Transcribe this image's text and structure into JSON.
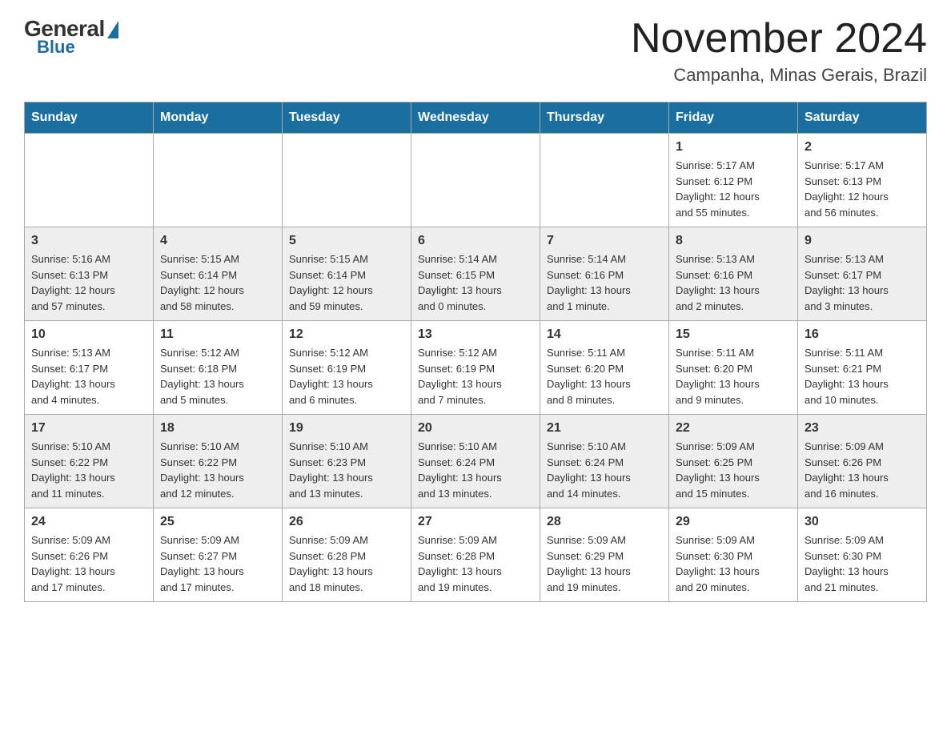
{
  "header": {
    "logo": {
      "general_text": "General",
      "blue_text": "Blue"
    },
    "title": "November 2024",
    "location": "Campanha, Minas Gerais, Brazil"
  },
  "calendar": {
    "days_of_week": [
      "Sunday",
      "Monday",
      "Tuesday",
      "Wednesday",
      "Thursday",
      "Friday",
      "Saturday"
    ],
    "weeks": [
      [
        {
          "day": "",
          "info": ""
        },
        {
          "day": "",
          "info": ""
        },
        {
          "day": "",
          "info": ""
        },
        {
          "day": "",
          "info": ""
        },
        {
          "day": "",
          "info": ""
        },
        {
          "day": "1",
          "info": "Sunrise: 5:17 AM\nSunset: 6:12 PM\nDaylight: 12 hours\nand 55 minutes."
        },
        {
          "day": "2",
          "info": "Sunrise: 5:17 AM\nSunset: 6:13 PM\nDaylight: 12 hours\nand 56 minutes."
        }
      ],
      [
        {
          "day": "3",
          "info": "Sunrise: 5:16 AM\nSunset: 6:13 PM\nDaylight: 12 hours\nand 57 minutes."
        },
        {
          "day": "4",
          "info": "Sunrise: 5:15 AM\nSunset: 6:14 PM\nDaylight: 12 hours\nand 58 minutes."
        },
        {
          "day": "5",
          "info": "Sunrise: 5:15 AM\nSunset: 6:14 PM\nDaylight: 12 hours\nand 59 minutes."
        },
        {
          "day": "6",
          "info": "Sunrise: 5:14 AM\nSunset: 6:15 PM\nDaylight: 13 hours\nand 0 minutes."
        },
        {
          "day": "7",
          "info": "Sunrise: 5:14 AM\nSunset: 6:16 PM\nDaylight: 13 hours\nand 1 minute."
        },
        {
          "day": "8",
          "info": "Sunrise: 5:13 AM\nSunset: 6:16 PM\nDaylight: 13 hours\nand 2 minutes."
        },
        {
          "day": "9",
          "info": "Sunrise: 5:13 AM\nSunset: 6:17 PM\nDaylight: 13 hours\nand 3 minutes."
        }
      ],
      [
        {
          "day": "10",
          "info": "Sunrise: 5:13 AM\nSunset: 6:17 PM\nDaylight: 13 hours\nand 4 minutes."
        },
        {
          "day": "11",
          "info": "Sunrise: 5:12 AM\nSunset: 6:18 PM\nDaylight: 13 hours\nand 5 minutes."
        },
        {
          "day": "12",
          "info": "Sunrise: 5:12 AM\nSunset: 6:19 PM\nDaylight: 13 hours\nand 6 minutes."
        },
        {
          "day": "13",
          "info": "Sunrise: 5:12 AM\nSunset: 6:19 PM\nDaylight: 13 hours\nand 7 minutes."
        },
        {
          "day": "14",
          "info": "Sunrise: 5:11 AM\nSunset: 6:20 PM\nDaylight: 13 hours\nand 8 minutes."
        },
        {
          "day": "15",
          "info": "Sunrise: 5:11 AM\nSunset: 6:20 PM\nDaylight: 13 hours\nand 9 minutes."
        },
        {
          "day": "16",
          "info": "Sunrise: 5:11 AM\nSunset: 6:21 PM\nDaylight: 13 hours\nand 10 minutes."
        }
      ],
      [
        {
          "day": "17",
          "info": "Sunrise: 5:10 AM\nSunset: 6:22 PM\nDaylight: 13 hours\nand 11 minutes."
        },
        {
          "day": "18",
          "info": "Sunrise: 5:10 AM\nSunset: 6:22 PM\nDaylight: 13 hours\nand 12 minutes."
        },
        {
          "day": "19",
          "info": "Sunrise: 5:10 AM\nSunset: 6:23 PM\nDaylight: 13 hours\nand 13 minutes."
        },
        {
          "day": "20",
          "info": "Sunrise: 5:10 AM\nSunset: 6:24 PM\nDaylight: 13 hours\nand 13 minutes."
        },
        {
          "day": "21",
          "info": "Sunrise: 5:10 AM\nSunset: 6:24 PM\nDaylight: 13 hours\nand 14 minutes."
        },
        {
          "day": "22",
          "info": "Sunrise: 5:09 AM\nSunset: 6:25 PM\nDaylight: 13 hours\nand 15 minutes."
        },
        {
          "day": "23",
          "info": "Sunrise: 5:09 AM\nSunset: 6:26 PM\nDaylight: 13 hours\nand 16 minutes."
        }
      ],
      [
        {
          "day": "24",
          "info": "Sunrise: 5:09 AM\nSunset: 6:26 PM\nDaylight: 13 hours\nand 17 minutes."
        },
        {
          "day": "25",
          "info": "Sunrise: 5:09 AM\nSunset: 6:27 PM\nDaylight: 13 hours\nand 17 minutes."
        },
        {
          "day": "26",
          "info": "Sunrise: 5:09 AM\nSunset: 6:28 PM\nDaylight: 13 hours\nand 18 minutes."
        },
        {
          "day": "27",
          "info": "Sunrise: 5:09 AM\nSunset: 6:28 PM\nDaylight: 13 hours\nand 19 minutes."
        },
        {
          "day": "28",
          "info": "Sunrise: 5:09 AM\nSunset: 6:29 PM\nDaylight: 13 hours\nand 19 minutes."
        },
        {
          "day": "29",
          "info": "Sunrise: 5:09 AM\nSunset: 6:30 PM\nDaylight: 13 hours\nand 20 minutes."
        },
        {
          "day": "30",
          "info": "Sunrise: 5:09 AM\nSunset: 6:30 PM\nDaylight: 13 hours\nand 21 minutes."
        }
      ]
    ]
  }
}
